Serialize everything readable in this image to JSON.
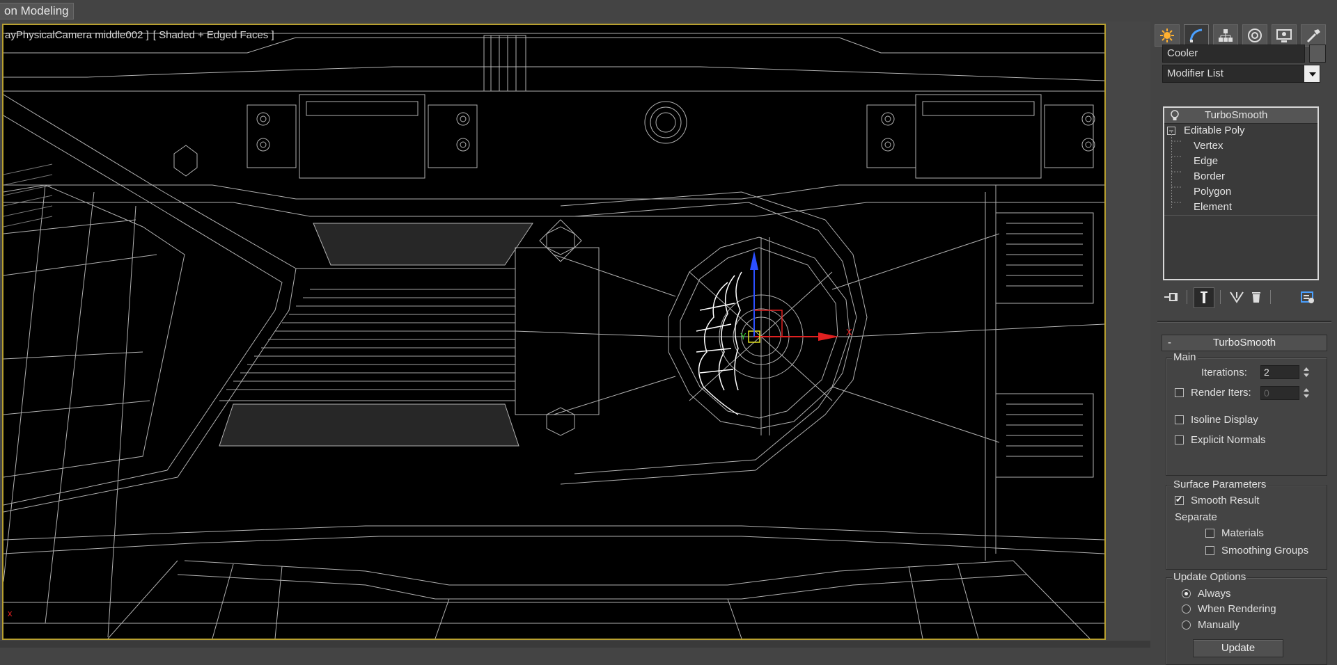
{
  "ribbon": {
    "tab_label": "on Modeling"
  },
  "viewport": {
    "camera_label": "ayPhysicalCamera middle002 ]",
    "shading_label": "[ Shaded + Edged Faces ]",
    "gizmo_axis_y": "Y",
    "gizmo_axis_x": "X",
    "corner_axis": "x",
    "accent_color": "#b8a030"
  },
  "command_panel": {
    "tabs": [
      {
        "name": "create",
        "icon": "create-icon"
      },
      {
        "name": "modify",
        "icon": "modify-icon"
      },
      {
        "name": "hierarchy",
        "icon": "hierarchy-icon"
      },
      {
        "name": "motion",
        "icon": "motion-icon"
      },
      {
        "name": "display",
        "icon": "display-icon"
      },
      {
        "name": "utilities",
        "icon": "utilities-icon"
      }
    ],
    "object_name": "Cooler",
    "modifier_list_label": "Modifier List",
    "stack": {
      "items": [
        {
          "label": "TurboSmooth"
        },
        {
          "label": "Editable Poly"
        },
        {
          "label": "Vertex"
        },
        {
          "label": "Edge"
        },
        {
          "label": "Border"
        },
        {
          "label": "Polygon"
        },
        {
          "label": "Element"
        }
      ]
    },
    "turbosmooth": {
      "title": "TurboSmooth",
      "collapse": "-",
      "main": {
        "group": "Main",
        "iterations_label": "Iterations:",
        "iterations_value": "2",
        "render_iters_label": "Render Iters:",
        "render_iters_value": "0",
        "render_iters_checked": false,
        "isoline_label": "Isoline Display",
        "isoline_checked": false,
        "explicit_normals_label": "Explicit Normals",
        "explicit_normals_checked": false
      },
      "surface": {
        "group": "Surface Parameters",
        "smooth_result_label": "Smooth Result",
        "smooth_result_checked": true,
        "separate_label": "Separate",
        "materials_label": "Materials",
        "materials_checked": false,
        "smoothing_groups_label": "Smoothing Groups",
        "smoothing_groups_checked": false
      },
      "update": {
        "group": "Update Options",
        "always_label": "Always",
        "when_rendering_label": "When Rendering",
        "manually_label": "Manually",
        "selected": "Always",
        "update_button": "Update"
      }
    }
  }
}
